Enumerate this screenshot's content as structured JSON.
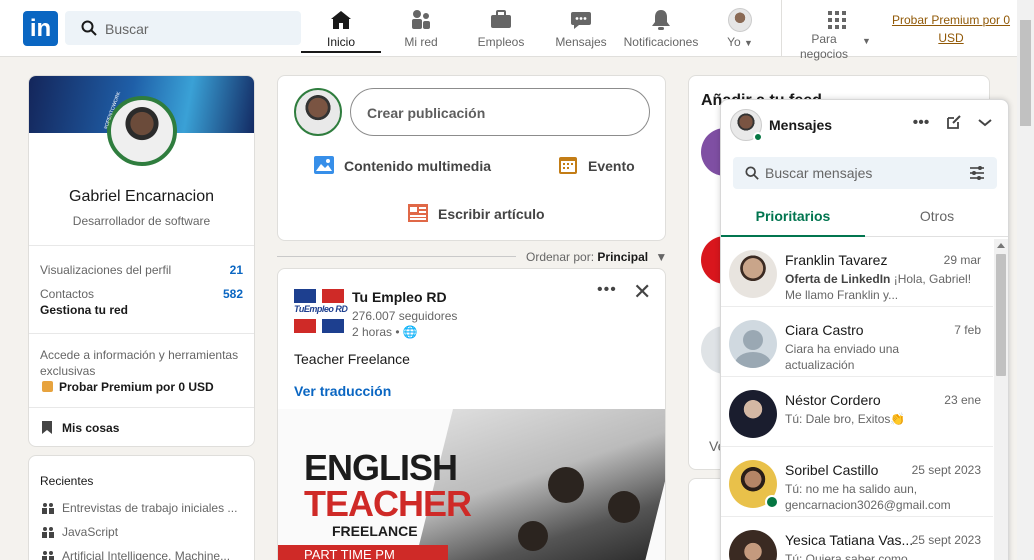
{
  "nav": {
    "logo": "in",
    "search_placeholder": "Buscar",
    "items": [
      {
        "label": "Inicio"
      },
      {
        "label": "Mi red"
      },
      {
        "label": "Empleos"
      },
      {
        "label": "Mensajes"
      },
      {
        "label": "Notificaciones"
      },
      {
        "label": "Yo"
      },
      {
        "label": "Para negocios"
      }
    ],
    "premium": "Probar Premium por 0 USD"
  },
  "profile": {
    "badge": "#OPENTOWORK",
    "name": "Gabriel Encarnacion",
    "title": "Desarrollador de software",
    "views_label": "Visualizaciones del perfil",
    "views_value": "21",
    "contacts_label": "Contactos",
    "contacts_value": "582",
    "contacts_sub": "Gestiona tu red",
    "premium_note": "Accede a información y herramientas exclusivas",
    "premium_link": "Probar Premium por 0 USD",
    "my_items": "Mis cosas"
  },
  "recent": {
    "title": "Recientes",
    "items": [
      {
        "label": "Entrevistas de trabajo iniciales ..."
      },
      {
        "label": "JavaScript"
      },
      {
        "label": "Artificial Intelligence, Machine..."
      }
    ]
  },
  "share": {
    "placeholder": "Crear publicación",
    "media": "Contenido multimedia",
    "event": "Evento",
    "article": "Escribir artículo"
  },
  "sort": {
    "label": "Ordenar por:",
    "value": "Principal"
  },
  "post": {
    "author": "Tu Empleo RD",
    "followers": "276.007 seguidores",
    "time": "2 horas •",
    "text": "Teacher Freelance",
    "translate": "Ver traducción",
    "img_line1": "ENGLISH",
    "img_line2": "TEACHER",
    "img_line3": "FREELANCE",
    "img_line4": "PART TIME PM",
    "logo_text": "TuEmpleo RD"
  },
  "feed": {
    "title": "Añadir a tu feed",
    "partial": "Ve"
  },
  "messaging": {
    "title": "Mensajes",
    "search_placeholder": "Buscar mensajes",
    "tabs": [
      {
        "label": "Prioritarios"
      },
      {
        "label": "Otros"
      }
    ],
    "conversations": [
      {
        "name": "Franklin Tavarez",
        "date": "29 mar",
        "preview_bold": "Oferta de LinkedIn",
        "preview": " ¡Hola, Gabriel! Me llamo Franklin y...",
        "color": "#c9a58a"
      },
      {
        "name": "Ciara Castro",
        "date": "7 feb",
        "preview_bold": "",
        "preview": "Ciara ha enviado una actualización",
        "color": "#a8b6c4"
      },
      {
        "name": "Néstor Cordero",
        "date": "23 ene",
        "preview_bold": "",
        "preview": "Tú: Dale bro, Exitos👏",
        "color": "#2a2f45"
      },
      {
        "name": "Soribel Castillo",
        "date": "25 sept 2023",
        "preview_bold": "",
        "preview": "Tú: no me ha salido aun, gencarnacion3026@gmail.com",
        "color": "#e2b23b"
      },
      {
        "name": "Yesica Tatiana Vas...",
        "date": "25 sept 2023",
        "preview_bold": "",
        "preview": "Tú: Quiera saber como",
        "color": "#5b4438"
      }
    ]
  },
  "colors": {
    "brand": "#0a66c2",
    "green": "#01754f",
    "premium": "#915907"
  }
}
